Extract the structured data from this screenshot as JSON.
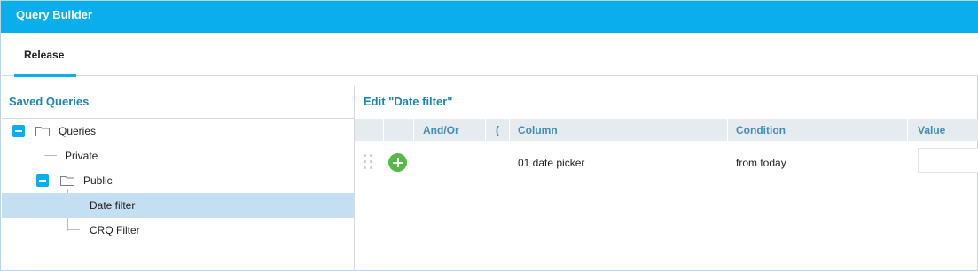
{
  "window": {
    "title": "Query Builder"
  },
  "tabs": [
    {
      "label": "Release",
      "active": true
    }
  ],
  "saved_queries": {
    "title": "Saved Queries",
    "tree": [
      {
        "label": "Queries",
        "level": 0,
        "expanded": true,
        "folder": true
      },
      {
        "label": "Private",
        "level": 1,
        "folder": false
      },
      {
        "label": "Public",
        "level": 1,
        "expanded": true,
        "folder": true
      },
      {
        "label": "Date filter",
        "level": 2,
        "selected": true
      },
      {
        "label": "CRQ Filter",
        "level": 2
      }
    ]
  },
  "editor": {
    "title": "Edit \"Date filter\"",
    "columns": [
      "And/Or",
      "(",
      "Column",
      "Condition",
      "Value"
    ],
    "rows": [
      {
        "and_or": "",
        "paren": "",
        "column": "01 date picker",
        "condition": "from today",
        "value": ""
      }
    ]
  },
  "colors": {
    "accent": "#0aaeea",
    "title_text": "#1a86b8",
    "header_text": "#3d8fb8",
    "selected_row": "#c5dff2",
    "add_button": "#56b947",
    "grid_header_bg": "#e6ebf0"
  },
  "icons": [
    "minus-toggle-icon",
    "folder-icon",
    "drag-handle-icon",
    "add-icon"
  ]
}
